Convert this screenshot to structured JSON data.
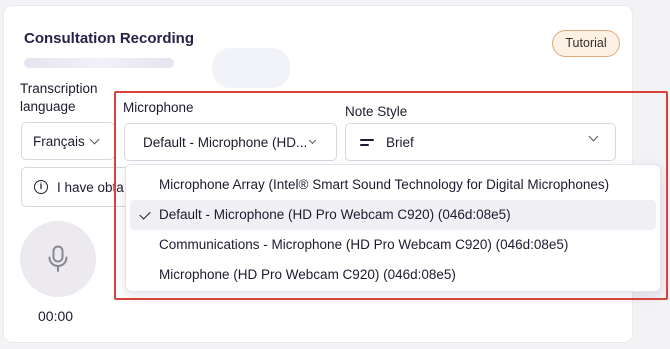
{
  "card": {
    "title": "Consultation Recording",
    "tutorial_label": "Tutorial"
  },
  "fields": {
    "transcription_label": "Transcription language",
    "transcription_value": "Français",
    "microphone_label": "Microphone",
    "microphone_value": "Default - Microphone (HD...",
    "note_style_label": "Note Style",
    "note_style_value": "Brief"
  },
  "info": {
    "text": "I have obta"
  },
  "recorder": {
    "timer": "00:00"
  },
  "dropdown": {
    "items": [
      {
        "label": "Microphone Array (Intel® Smart Sound Technology for Digital Microphones)",
        "selected": false
      },
      {
        "label": "Default - Microphone (HD Pro Webcam C920) (046d:08e5)",
        "selected": true
      },
      {
        "label": "Communications - Microphone (HD Pro Webcam C920) (046d:08e5)",
        "selected": false
      },
      {
        "label": "Microphone (HD Pro Webcam C920) (046d:08e5)",
        "selected": false
      }
    ]
  },
  "colors": {
    "accent_highlight": "#d9423c",
    "tutorial_border": "#e2a878",
    "tutorial_bg": "#fdf1e6",
    "title": "#2a2146"
  },
  "icons": {
    "tutorial": "none",
    "info": "info-icon",
    "note_style": "lines-icon",
    "mic": "microphone-icon",
    "selected": "check-icon"
  }
}
